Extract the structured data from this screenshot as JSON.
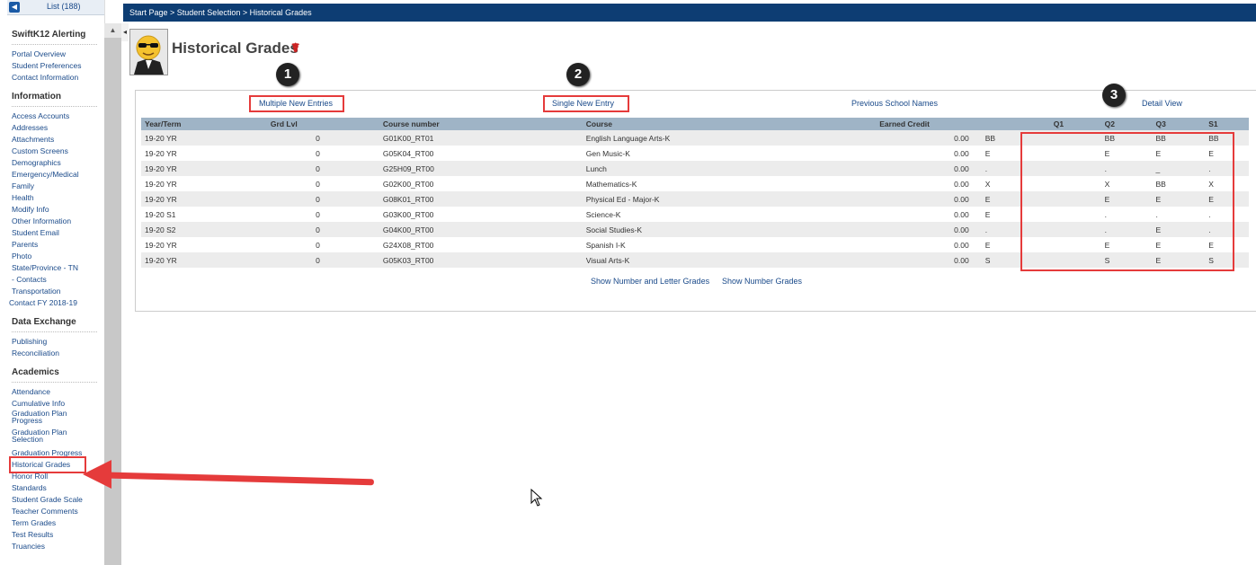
{
  "breadcrumb": "Start Page > Student Selection > Historical Grades",
  "sidebar": {
    "list_label": "List (188)",
    "sections": [
      {
        "title": "SwiftK12 Alerting",
        "items": [
          "Portal Overview",
          "Student Preferences",
          "Contact Information"
        ]
      },
      {
        "title": "Information",
        "items": [
          "Access Accounts",
          "Addresses",
          "Attachments",
          "Custom Screens",
          "Demographics",
          "Emergency/Medical",
          "Family",
          "Health",
          "Modify Info",
          "Other Information",
          "Student Email",
          "Parents",
          "Photo",
          "State/Province - TN",
          " - Contacts",
          "Transportation",
          "Contact FY 2018-19"
        ]
      },
      {
        "title": "Data Exchange",
        "items": [
          "Publishing",
          "Reconciliation"
        ]
      },
      {
        "title": "Academics",
        "items": [
          "Attendance",
          "Cumulative Info",
          "Graduation Plan Progress",
          "Graduation Plan Selection",
          "Graduation Progress",
          "Historical Grades",
          "Honor Roll",
          "Standards",
          "Student Grade Scale",
          "Teacher Comments",
          "Term Grades",
          "Test Results",
          "Truancies"
        ]
      }
    ]
  },
  "page": {
    "title": "Historical Grades",
    "multiple_new_entries": "Multiple New Entries",
    "single_new_entry": "Single New Entry",
    "previous_school_names": "Previous School Names",
    "detail_view": "Detail View",
    "show_number_and_letter": "Show Number and Letter Grades",
    "show_number": "Show Number Grades",
    "badges": [
      "1",
      "2",
      "3"
    ]
  },
  "table": {
    "headers": [
      "Year/Term",
      "Grd Lvl",
      "Course number",
      "Course",
      "Earned Credit",
      "Q1",
      "Q2",
      "Q3",
      "S1"
    ],
    "rows": [
      [
        "19-20 YR",
        "0",
        "G01K00_RT01",
        "English Language Arts-K",
        "0.00",
        "BB",
        "BB",
        "BB",
        "BB"
      ],
      [
        "19-20 YR",
        "0",
        "G05K04_RT00",
        "Gen Music-K",
        "0.00",
        "E",
        "E",
        "E",
        "E"
      ],
      [
        "19-20 YR",
        "0",
        "G25H09_RT00",
        "Lunch",
        "0.00",
        ".",
        ".",
        "_",
        "."
      ],
      [
        "19-20 YR",
        "0",
        "G02K00_RT00",
        "Mathematics-K",
        "0.00",
        "X",
        "X",
        "BB",
        "X"
      ],
      [
        "19-20 YR",
        "0",
        "G08K01_RT00",
        "Physical Ed - Major-K",
        "0.00",
        "E",
        "E",
        "E",
        "E"
      ],
      [
        "19-20 S1",
        "0",
        "G03K00_RT00",
        "Science-K",
        "0.00",
        "E",
        ".",
        ".",
        "."
      ],
      [
        "19-20 S2",
        "0",
        "G04K00_RT00",
        "Social Studies-K",
        "0.00",
        ".",
        ".",
        "E",
        "."
      ],
      [
        "19-20 YR",
        "0",
        "G24X08_RT00",
        "Spanish I-K",
        "0.00",
        "E",
        "E",
        "E",
        "E"
      ],
      [
        "19-20 YR",
        "0",
        "G05K03_RT00",
        "Visual Arts-K",
        "0.00",
        "S",
        "S",
        "E",
        "S"
      ]
    ]
  },
  "colors": {
    "topbar": "#0d3d73",
    "accent": "#e53b3b",
    "link": "#1a4a8a"
  }
}
